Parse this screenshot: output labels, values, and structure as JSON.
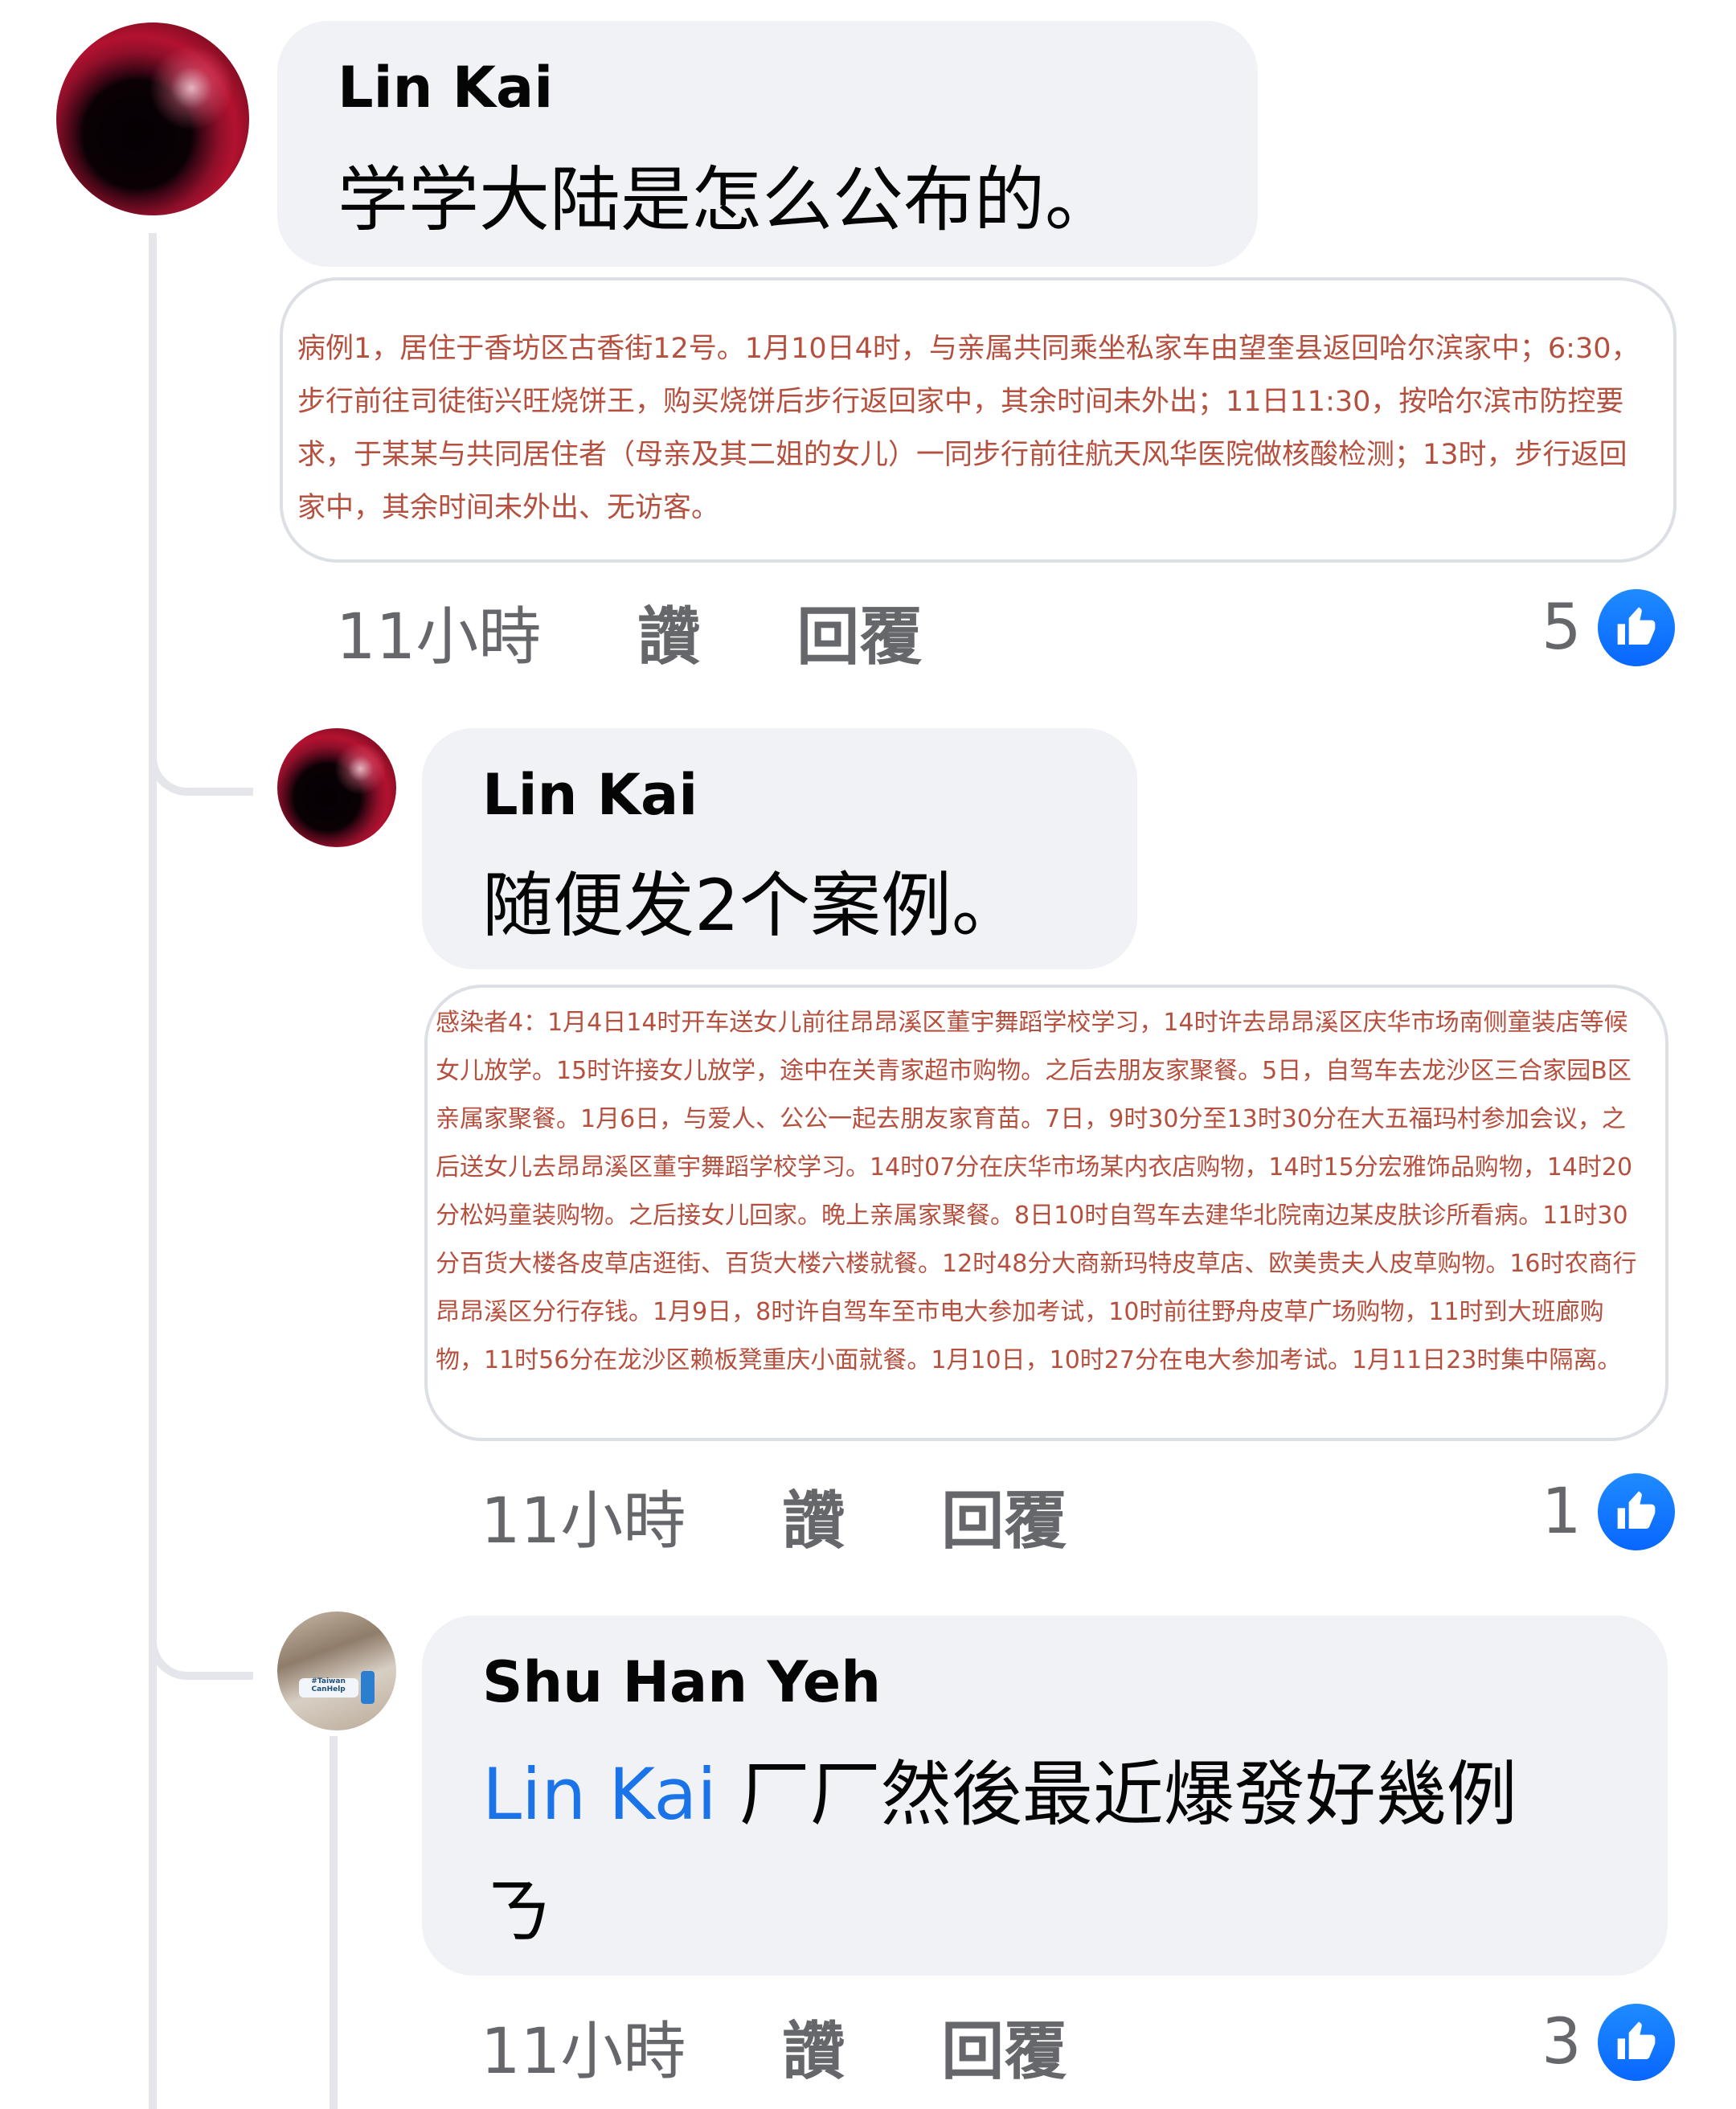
{
  "comments": [
    {
      "author": "Lin Kai",
      "text": "学学大陆是怎么公布的。",
      "image_text": "病例1，居住于香坊区古香街12号。1月10日4时，与亲属共同乘坐私家车由望奎县返回哈尔滨家中；6:30，步行前往司徒街兴旺烧饼王，购买烧饼后步行返回家中，其余时间未外出；11日11:30，按哈尔滨市防控要求，于某某与共同居住者（母亲及其二姐的女儿）一同步行前往航天风华医院做核酸检测；13时，步行返回家中，其余时间未外出、无访客。",
      "time": "11小時",
      "like_label": "讚",
      "reply_label": "回覆",
      "reactions": "5"
    },
    {
      "author": "Lin Kai",
      "text": "随便发2个案例。",
      "image_text": "感染者4：1月4日14时开车送女儿前往昂昂溪区董宇舞蹈学校学习，14时许去昂昂溪区庆华市场南侧童装店等候女儿放学。15时许接女儿放学，途中在关青家超市购物。之后去朋友家聚餐。5日，自驾车去龙沙区三合家园B区亲属家聚餐。1月6日，与爱人、公公一起去朋友家育苗。7日，9时30分至13时30分在大五福玛村参加会议，之后送女儿去昂昂溪区董宇舞蹈学校学习。14时07分在庆华市场某内衣店购物，14时15分宏雅饰品购物，14时20分松妈童装购物。之后接女儿回家。晚上亲属家聚餐。8日10时自驾车去建华北院南边某皮肤诊所看病。11时30分百货大楼各皮草店逛街、百货大楼六楼就餐。12时48分大商新玛特皮草店、欧美贵夫人皮草购物。16时农商行昂昂溪区分行存钱。1月9日，8时许自驾车至市电大参加考试，10时前往野舟皮草广场购物，11时到大班廊购物，11时56分在龙沙区赖板凳重庆小面就餐。1月10日，10时27分在电大参加考试。1月11日23时集中隔离。",
      "time": "11小時",
      "like_label": "讚",
      "reply_label": "回覆",
      "reactions": "1"
    },
    {
      "author": "Shu Han Yeh",
      "mention": "Lin Kai",
      "text_line1": " 厂厂然後最近爆發好幾例",
      "text_line2": "ㄋ",
      "badge_text": "#Taiwan CanHelp",
      "time": "11小時",
      "like_label": "讚",
      "reply_label": "回覆",
      "reactions": "3"
    }
  ],
  "colors": {
    "bubble": "#f0f2f5",
    "meta_text": "#65676b",
    "mention": "#1a73e8",
    "like": "#0866ff",
    "card_text": "#b5503f"
  },
  "icons": [
    "thumbs-up-icon"
  ]
}
